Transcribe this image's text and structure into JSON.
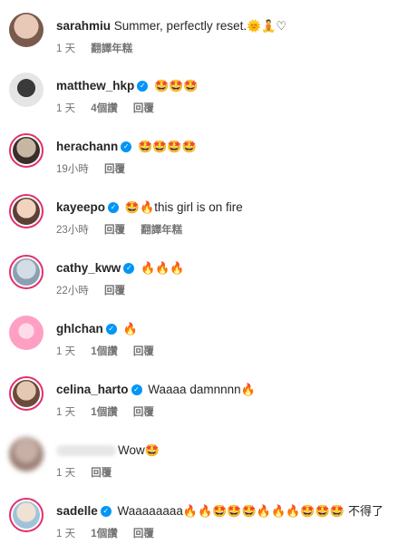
{
  "comments": [
    {
      "username": "sarahmiu",
      "verified": false,
      "text": "Summer, perfectly reset.",
      "emoji": "🌞🧘♡",
      "time": "1 天",
      "likes": "",
      "reply": "",
      "translate": "翻譯年糕",
      "colors": [
        "#e8c9b8",
        "#7a5a4c"
      ]
    },
    {
      "username": "matthew_hkp",
      "verified": true,
      "text": "",
      "emoji": "🤩🤩🤩",
      "time": "1 天",
      "likes": "4個讚",
      "reply": "回覆",
      "translate": "",
      "colors": [
        "#d9d9d9",
        "#2b2b2b"
      ]
    },
    {
      "username": "herachann",
      "verified": true,
      "text": "",
      "emoji": "🤩🤩🤩🤩",
      "time": "19小時",
      "likes": "",
      "reply": "回覆",
      "translate": "",
      "colors": [
        "#c7b6a3",
        "#3a2e2a"
      ]
    },
    {
      "username": "kayeepo",
      "verified": true,
      "text": "this girl is on fire",
      "emoji": "🤩🔥",
      "time": "23小時",
      "likes": "",
      "reply": "回覆",
      "translate": "翻譯年糕",
      "colors": [
        "#f1d3c0",
        "#5c4036"
      ]
    },
    {
      "username": "cathy_kww",
      "verified": true,
      "text": "",
      "emoji": "🔥🔥🔥",
      "time": "22小時",
      "likes": "",
      "reply": "回覆",
      "translate": "",
      "colors": [
        "#d5dde4",
        "#8aa0b2"
      ]
    },
    {
      "username": "ghlchan",
      "verified": true,
      "text": "",
      "emoji": "🔥",
      "time": "1 天",
      "likes": "1個讚",
      "reply": "回覆",
      "translate": "",
      "colors": [
        "#ff9fc3",
        "#ffdbe8"
      ]
    },
    {
      "username": "celina_harto",
      "verified": true,
      "text": "Waaaa damnnnn",
      "emoji": "🔥",
      "time": "1 天",
      "likes": "1個讚",
      "reply": "回覆",
      "translate": "",
      "colors": [
        "#e4c8b4",
        "#6c4a3a"
      ]
    },
    {
      "username": "",
      "verified": false,
      "text": "Wow",
      "emoji": "🤩",
      "time": "1 天",
      "likes": "",
      "reply": "回覆",
      "translate": "",
      "colors": [
        "#c8b0a8",
        "#9a7e72"
      ]
    },
    {
      "username": "sadelle",
      "verified": true,
      "text": "Waaaaaaaa",
      "emoji": "🔥🔥🤩🤩🤩🔥🔥🔥🤩🤩🤩  不得了",
      "time": "1 天",
      "likes": "1個讚",
      "reply": "回覆",
      "translate": "",
      "colors": [
        "#9fc3da",
        "#efe1d3"
      ]
    }
  ]
}
